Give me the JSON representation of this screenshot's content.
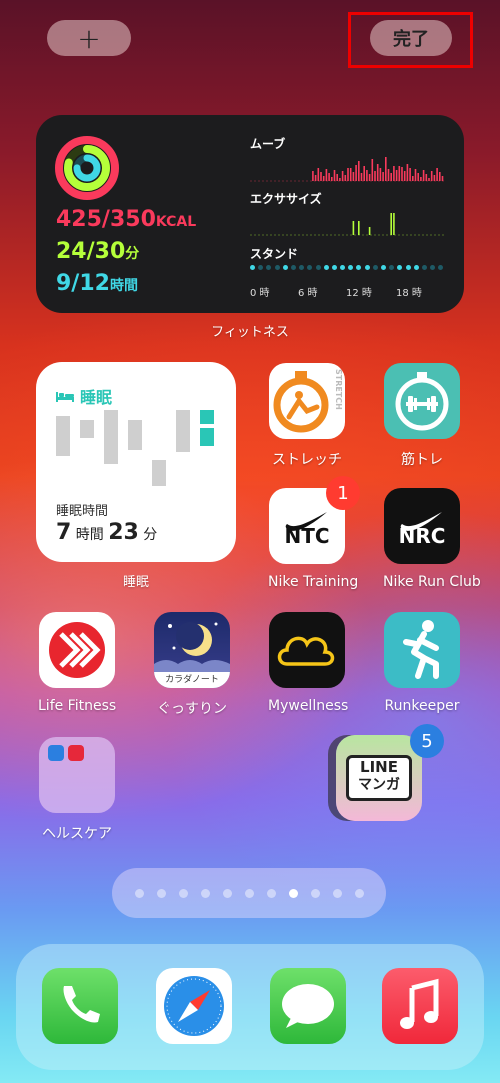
{
  "top_bar": {
    "add_label": "+",
    "done_label": "完了"
  },
  "fitness": {
    "move": "425/350",
    "move_unit": "KCAL",
    "exercise": "24/30",
    "exercise_unit": "分",
    "stand": "9/12",
    "stand_unit": "時間",
    "move_label": "ムーブ",
    "exercise_label": "エクササイズ",
    "stand_label": "スタンド",
    "hours": [
      "0 時",
      "6 時",
      "12 時",
      "18 時"
    ],
    "caption": "フィットネス",
    "colors": {
      "move": "#fa3a5c",
      "exercise": "#b5ff3a",
      "stand": "#40d8e6"
    }
  },
  "sleep": {
    "title": "睡眠",
    "duration_label": "睡眠時間",
    "hours_value": "7",
    "hours_unit": "時間",
    "minutes_value": "23",
    "minutes_unit": "分",
    "caption": "睡眠"
  },
  "apps": {
    "stretch": "ストレッチ",
    "stretch_icon_text": "STRETCH",
    "kintore": "筋トレ",
    "ntc": "Nike Training",
    "ntc_icon_text": "NTC",
    "ntc_badge": "1",
    "nrc": "Nike Run Club",
    "nrc_icon_text": "NRC",
    "life_fitness": "Life Fitness",
    "gussurin": "ぐっすりン",
    "gussurin_icon_text": "カラダノート",
    "mywellness": "Mywellness",
    "runkeeper": "Runkeeper",
    "healthcare": "ヘルスケア",
    "line_manga_icon_line1": "LINE",
    "line_manga_icon_line2": "マンガ",
    "line_manga_badge": "5"
  },
  "page_indicator": {
    "count": 11,
    "active": 8
  },
  "dock": [
    "phone-icon",
    "safari-icon",
    "messages-icon",
    "music-icon"
  ]
}
